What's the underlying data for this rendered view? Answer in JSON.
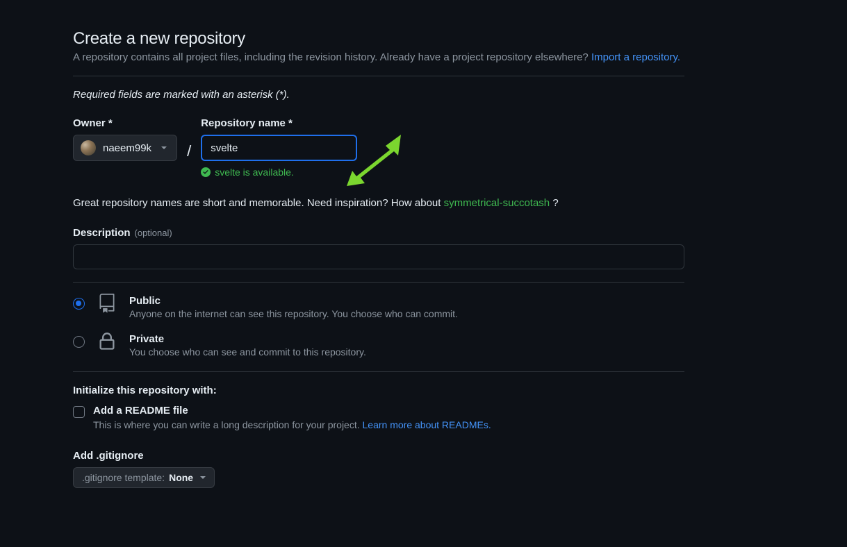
{
  "header": {
    "title": "Create a new repository",
    "subtitle": "A repository contains all project files, including the revision history. Already have a project repository elsewhere?",
    "import_link": "Import a repository."
  },
  "required_note": "Required fields are marked with an asterisk (*).",
  "owner": {
    "label": "Owner *",
    "username": "naeem99k"
  },
  "repo": {
    "label": "Repository name *",
    "value": "svelte",
    "availability": "svelte is available."
  },
  "inspiration": {
    "prefix": "Great repository names are short and memorable. Need inspiration? How about ",
    "suggestion": "symmetrical-succotash",
    "suffix": " ?"
  },
  "description": {
    "label": "Description",
    "optional": "(optional)",
    "value": ""
  },
  "visibility": {
    "public": {
      "title": "Public",
      "desc": "Anyone on the internet can see this repository. You choose who can commit."
    },
    "private": {
      "title": "Private",
      "desc": "You choose who can see and commit to this repository."
    }
  },
  "init": {
    "heading": "Initialize this repository with:",
    "readme_label": "Add a README file",
    "readme_desc": "This is where you can write a long description for your project. ",
    "readme_link": "Learn more about READMEs."
  },
  "gitignore": {
    "label": "Add .gitignore",
    "template_prefix": ".gitignore template: ",
    "template_value": "None"
  }
}
